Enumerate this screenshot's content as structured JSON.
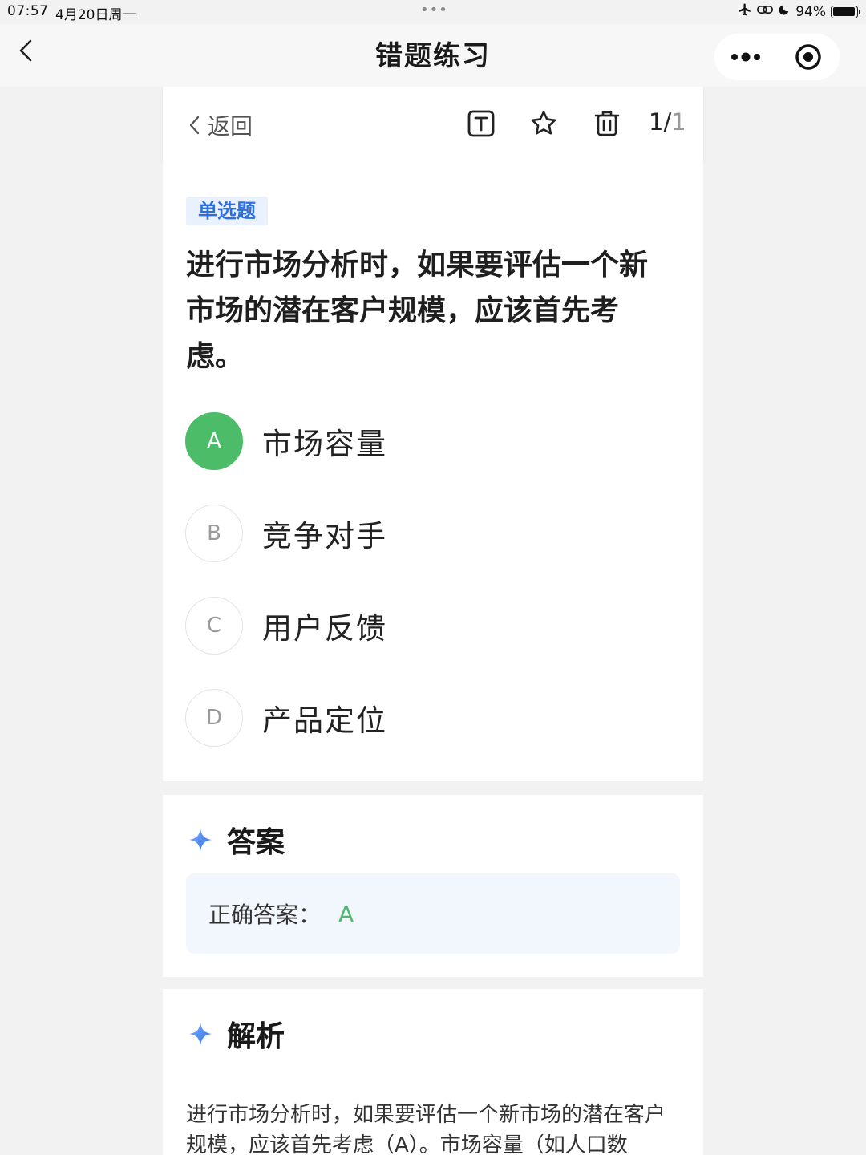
{
  "status_bar": {
    "time": "07:57",
    "date": "4月20日周一",
    "dots": "•••",
    "battery": "94%",
    "battery_level": 0.94
  },
  "nav": {
    "title": "错题练习"
  },
  "toolbar": {
    "back_label": "返回",
    "counter_current": "1/",
    "counter_total": "1"
  },
  "question": {
    "type_tag": "单选题",
    "text": "进行市场分析时，如果要评估一个新市场的潜在客户规模，应该首先考虑。",
    "options": [
      {
        "letter": "A",
        "text": "市场容量",
        "selected": true
      },
      {
        "letter": "B",
        "text": "竞争对手",
        "selected": false
      },
      {
        "letter": "C",
        "text": "用户反馈",
        "selected": false
      },
      {
        "letter": "D",
        "text": "产品定位",
        "selected": false
      }
    ]
  },
  "answer": {
    "section_title": "答案",
    "label": "正确答案：",
    "value": "A"
  },
  "analysis": {
    "section_title": "解析",
    "text": "进行市场分析时，如果要评估一个新市场的潜在客户规模，应该首先考虑（A）。市场容量（如人口数"
  },
  "colors": {
    "accent_blue": "#2d6fe0",
    "correct_green": "#4cbc68",
    "tag_bg": "#e9f1fd"
  }
}
